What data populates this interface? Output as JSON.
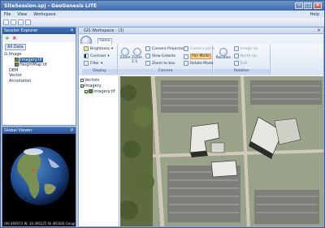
{
  "window": {
    "title": "SiteSession.spj - GeoGenesis LITE"
  },
  "menu": {
    "items": [
      "File",
      "View",
      "Workspace"
    ],
    "help": "Help"
  },
  "session_explorer": {
    "title": "Session Explorer",
    "filter": "All Data",
    "tree": {
      "image": "Image",
      "imagery": "Imagery.tif",
      "heightmap": "HeightMap.tif",
      "dem": "DEM",
      "vector": "Vector",
      "annotation": "Annotation"
    }
  },
  "global_viewer": {
    "title": "Global Viewer",
    "status": "(96.466973 W, 34.466225 N) WGS84 Geograp"
  },
  "workspace": {
    "title": "GIS Workspace - (3)",
    "tab": "Home",
    "display": {
      "brightness": "Brightness",
      "contrast": "Contrast",
      "filter": "Filter",
      "label": "Display"
    },
    "camera": {
      "zoom": "Zoom",
      "zoom_11": "Zoom 1:1",
      "camera_projection": "Camera Projection",
      "view_extents": "View Extents",
      "zoom_to_box": "Zoom to box",
      "camera_pitch": "Camera pitch",
      "pan_mode": "Pan Mode",
      "rotate_mode": "Rotate Mode",
      "label": "Camera"
    },
    "rotation": {
      "rotation": "Rotation",
      "image_up": "Image Up",
      "north_up": "North Up",
      "edit": "Edit",
      "label": "Rotation"
    },
    "layers": {
      "vectors": "Vectors",
      "imagery": "Imagery",
      "imagery_file": "imagery.tif"
    }
  }
}
